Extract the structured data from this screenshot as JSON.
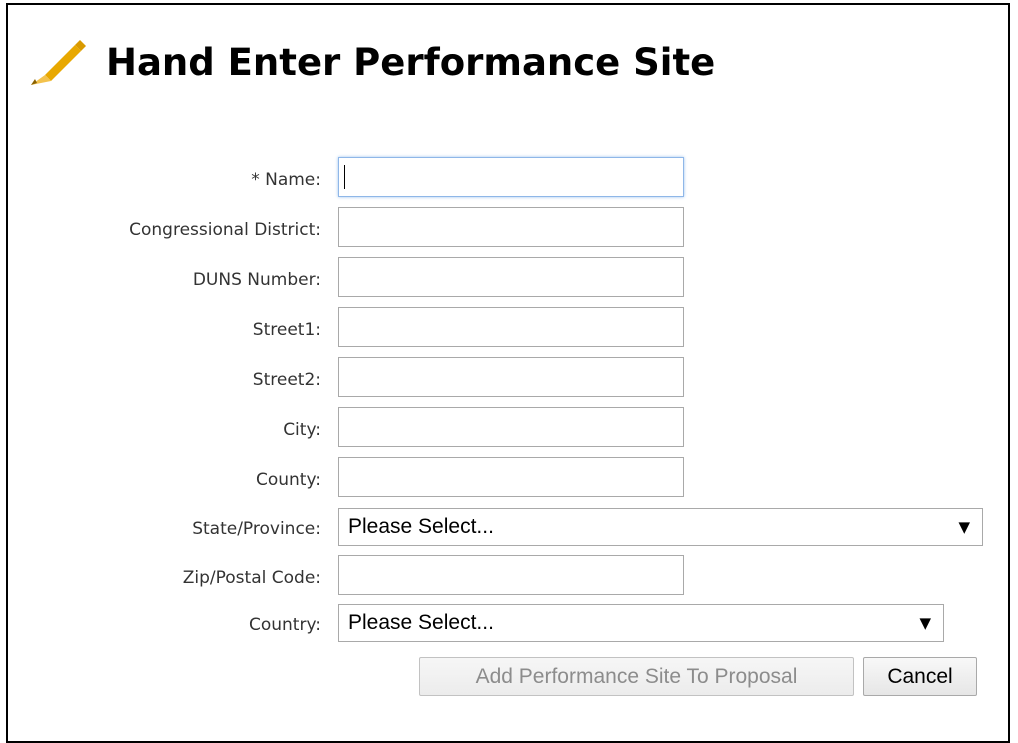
{
  "title": "Hand Enter Performance Site",
  "icons": {
    "title_icon": "pencil-icon",
    "dropdown_icon": "triangle-down-icon"
  },
  "form": {
    "name_label": "* Name:",
    "name_value": "",
    "congressional_district_label": "Congressional District:",
    "congressional_district_value": "",
    "duns_label": "DUNS Number:",
    "duns_value": "",
    "street1_label": "Street1:",
    "street1_value": "",
    "street2_label": "Street2:",
    "street2_value": "",
    "city_label": "City:",
    "city_value": "",
    "county_label": "County:",
    "county_value": "",
    "state_label": "State/Province:",
    "state_selected": "Please Select...",
    "zip_label": "Zip/Postal Code:",
    "zip_value": "",
    "country_label": "Country:",
    "country_selected": "Please Select...",
    "dropdown_arrow": "▼"
  },
  "buttons": {
    "add_label": "Add Performance Site To Proposal",
    "add_disabled": true,
    "cancel_label": "Cancel"
  },
  "colors": {
    "pencil_body": "#e8a800",
    "pencil_tip": "#f3c24d",
    "focus_border": "#8fb7e8",
    "border": "#a9a9a9"
  }
}
